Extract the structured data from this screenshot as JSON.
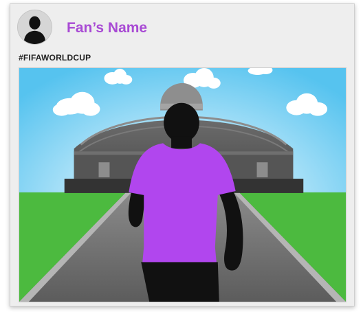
{
  "post": {
    "author_name": "Fan’s Name",
    "hashtag": "#FIFAWORLDCUP"
  },
  "colors": {
    "accent_purple": "#a84ad4",
    "shirt_purple": "#b146ee",
    "sky_blue": "#5ec8ef",
    "grass_green": "#4cba3f"
  },
  "icons": {
    "avatar": "person-silhouette-icon"
  }
}
